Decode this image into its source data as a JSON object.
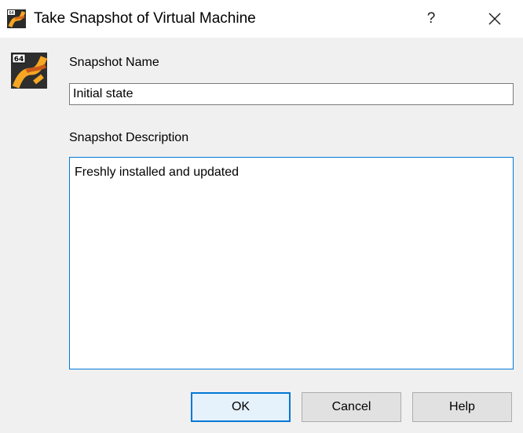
{
  "window": {
    "title": "Take Snapshot of Virtual Machine",
    "app_icon": "virtualbox-64-icon",
    "help_glyph": "?",
    "close_icon": "close-icon"
  },
  "form": {
    "vm_icon": "virtualbox-64-icon",
    "vm_icon_badge": "64",
    "name_label": "Snapshot Name",
    "name_value": "Initial state",
    "description_label": "Snapshot Description",
    "description_value": "Freshly installed and updated"
  },
  "buttons": {
    "ok_label": "OK",
    "cancel_label": "Cancel",
    "help_label": "Help"
  },
  "colors": {
    "accent": "#0078d7",
    "dialog_bg": "#f0f0f0",
    "titlebar_bg": "#ffffff"
  }
}
